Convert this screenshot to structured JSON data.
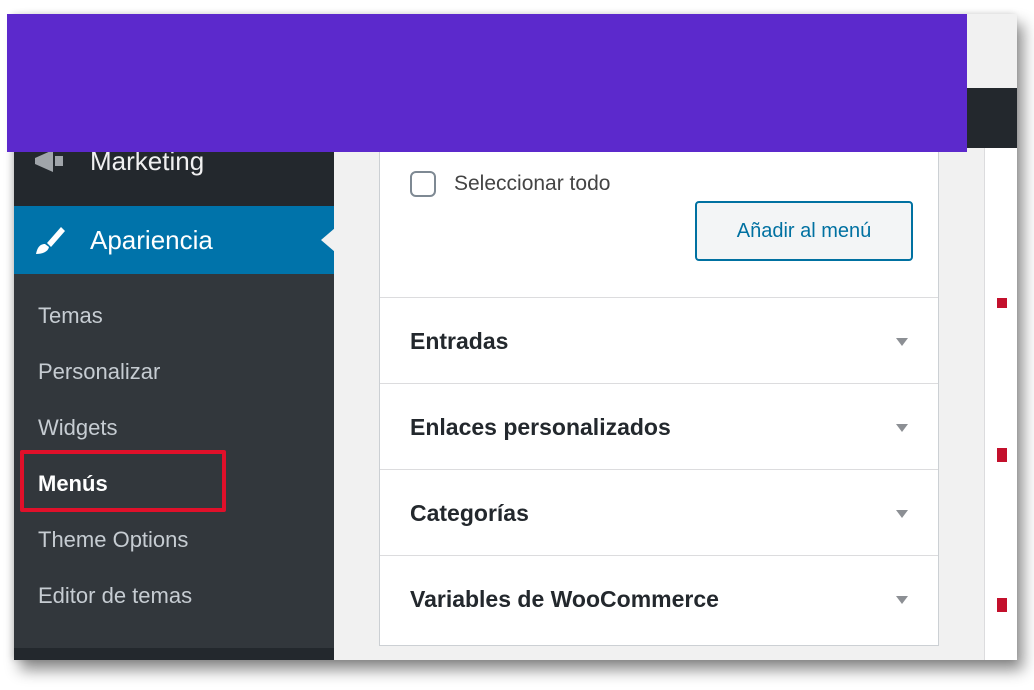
{
  "sidebar": {
    "marketing_label": "Marketing",
    "apariencia_label": "Apariencia",
    "submenu": [
      {
        "label": "Temas",
        "current": false
      },
      {
        "label": "Personalizar",
        "current": false
      },
      {
        "label": "Widgets",
        "current": false
      },
      {
        "label": "Menús",
        "current": true
      },
      {
        "label": "Theme Options",
        "current": false
      },
      {
        "label": "Editor de temas",
        "current": false
      }
    ]
  },
  "panel": {
    "select_all_label": "Seleccionar todo",
    "add_button_label": "Añadir al menú",
    "sections": [
      {
        "label": "Entradas"
      },
      {
        "label": "Enlaces personalizados"
      },
      {
        "label": "Categorías"
      },
      {
        "label": "Variables de WooCommerce"
      }
    ]
  },
  "colors": {
    "admin_dark": "#23282d",
    "submenu_bg": "#32373c",
    "active_blue": "#0073aa",
    "highlight_red": "#e0102a",
    "banner_purple": "#5c29cc"
  },
  "icons": {
    "marketing": "megaphone-icon",
    "apariencia": "paintbrush-icon",
    "section_toggle": "triangle-down-icon"
  }
}
